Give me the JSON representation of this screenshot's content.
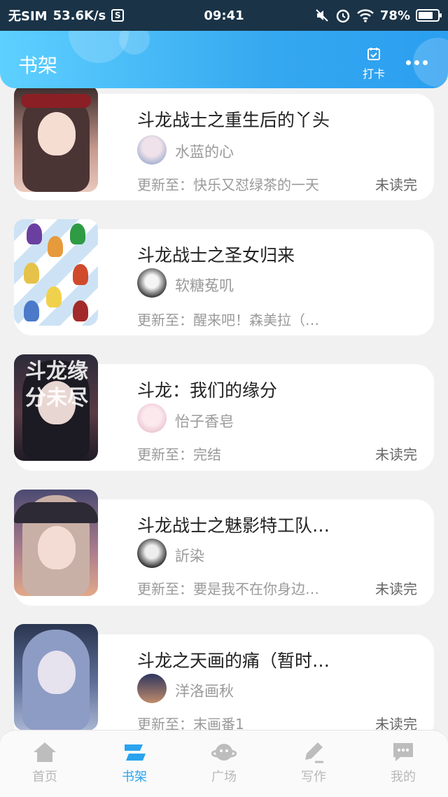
{
  "status_bar": {
    "carrier": "无SIM",
    "speed": "53.6K/s",
    "s_badge": "S",
    "time": "09:41",
    "battery": "78%",
    "battery_level": 0.78
  },
  "header": {
    "title": "书架",
    "checkin_label": "打卡"
  },
  "books": [
    {
      "title": "斗龙战士之重生后的丫头",
      "author": "水蓝的心",
      "update": "更新至：快乐又怼绿茶的一天",
      "status": "未读完"
    },
    {
      "title": "斗龙战士之圣女归来",
      "author": "软糖菟叽",
      "update": "更新至：醒来吧！森美拉（…",
      "status": ""
    },
    {
      "title": "斗龙：我们的缘分",
      "author": "怡子香皂",
      "update": "更新至：完结",
      "status": "未读完",
      "cover_text": "斗龙缘分未尽"
    },
    {
      "title": "斗龙战士之魅影特工队…",
      "author": "訢染",
      "update": "更新至：要是我不在你身边…",
      "status": "未读完"
    },
    {
      "title": "斗龙之天画的痛（暂时…",
      "author": "洋洛画秋",
      "update": "更新至：末画番1",
      "status": "未读完"
    }
  ],
  "tabbar": {
    "tabs": [
      {
        "label": "首页",
        "icon": "home-icon",
        "active": false
      },
      {
        "label": "书架",
        "icon": "bookshelf-icon",
        "active": true
      },
      {
        "label": "广场",
        "icon": "planet-icon",
        "active": false
      },
      {
        "label": "写作",
        "icon": "pen-icon",
        "active": false
      },
      {
        "label": "我的",
        "icon": "chat-bubble-icon",
        "active": false
      }
    ]
  },
  "colors": {
    "accent": "#2aa3ee",
    "header_start": "#5ed0ff",
    "header_end": "#2b9ff0",
    "background": "#f1f1f1"
  }
}
